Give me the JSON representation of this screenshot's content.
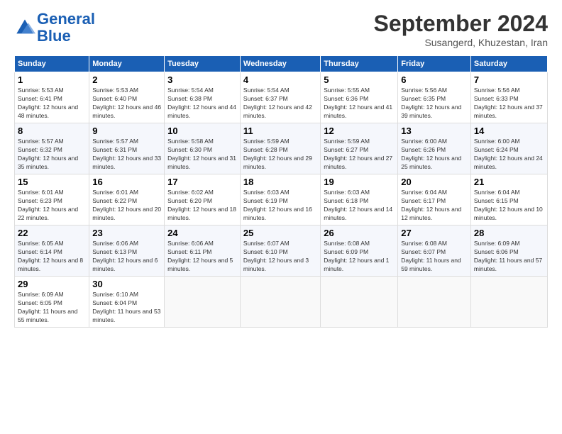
{
  "header": {
    "logo_line1": "General",
    "logo_line2": "Blue",
    "title": "September 2024",
    "subtitle": "Susangerd, Khuzestan, Iran"
  },
  "days_of_week": [
    "Sunday",
    "Monday",
    "Tuesday",
    "Wednesday",
    "Thursday",
    "Friday",
    "Saturday"
  ],
  "weeks": [
    [
      {
        "day": "1",
        "rise": "5:53 AM",
        "set": "6:41 PM",
        "daylight": "12 hours and 48 minutes."
      },
      {
        "day": "2",
        "rise": "5:53 AM",
        "set": "6:40 PM",
        "daylight": "12 hours and 46 minutes."
      },
      {
        "day": "3",
        "rise": "5:54 AM",
        "set": "6:38 PM",
        "daylight": "12 hours and 44 minutes."
      },
      {
        "day": "4",
        "rise": "5:54 AM",
        "set": "6:37 PM",
        "daylight": "12 hours and 42 minutes."
      },
      {
        "day": "5",
        "rise": "5:55 AM",
        "set": "6:36 PM",
        "daylight": "12 hours and 41 minutes."
      },
      {
        "day": "6",
        "rise": "5:56 AM",
        "set": "6:35 PM",
        "daylight": "12 hours and 39 minutes."
      },
      {
        "day": "7",
        "rise": "5:56 AM",
        "set": "6:33 PM",
        "daylight": "12 hours and 37 minutes."
      }
    ],
    [
      {
        "day": "8",
        "rise": "5:57 AM",
        "set": "6:32 PM",
        "daylight": "12 hours and 35 minutes."
      },
      {
        "day": "9",
        "rise": "5:57 AM",
        "set": "6:31 PM",
        "daylight": "12 hours and 33 minutes."
      },
      {
        "day": "10",
        "rise": "5:58 AM",
        "set": "6:30 PM",
        "daylight": "12 hours and 31 minutes."
      },
      {
        "day": "11",
        "rise": "5:59 AM",
        "set": "6:28 PM",
        "daylight": "12 hours and 29 minutes."
      },
      {
        "day": "12",
        "rise": "5:59 AM",
        "set": "6:27 PM",
        "daylight": "12 hours and 27 minutes."
      },
      {
        "day": "13",
        "rise": "6:00 AM",
        "set": "6:26 PM",
        "daylight": "12 hours and 25 minutes."
      },
      {
        "day": "14",
        "rise": "6:00 AM",
        "set": "6:24 PM",
        "daylight": "12 hours and 24 minutes."
      }
    ],
    [
      {
        "day": "15",
        "rise": "6:01 AM",
        "set": "6:23 PM",
        "daylight": "12 hours and 22 minutes."
      },
      {
        "day": "16",
        "rise": "6:01 AM",
        "set": "6:22 PM",
        "daylight": "12 hours and 20 minutes."
      },
      {
        "day": "17",
        "rise": "6:02 AM",
        "set": "6:20 PM",
        "daylight": "12 hours and 18 minutes."
      },
      {
        "day": "18",
        "rise": "6:03 AM",
        "set": "6:19 PM",
        "daylight": "12 hours and 16 minutes."
      },
      {
        "day": "19",
        "rise": "6:03 AM",
        "set": "6:18 PM",
        "daylight": "12 hours and 14 minutes."
      },
      {
        "day": "20",
        "rise": "6:04 AM",
        "set": "6:17 PM",
        "daylight": "12 hours and 12 minutes."
      },
      {
        "day": "21",
        "rise": "6:04 AM",
        "set": "6:15 PM",
        "daylight": "12 hours and 10 minutes."
      }
    ],
    [
      {
        "day": "22",
        "rise": "6:05 AM",
        "set": "6:14 PM",
        "daylight": "12 hours and 8 minutes."
      },
      {
        "day": "23",
        "rise": "6:06 AM",
        "set": "6:13 PM",
        "daylight": "12 hours and 6 minutes."
      },
      {
        "day": "24",
        "rise": "6:06 AM",
        "set": "6:11 PM",
        "daylight": "12 hours and 5 minutes."
      },
      {
        "day": "25",
        "rise": "6:07 AM",
        "set": "6:10 PM",
        "daylight": "12 hours and 3 minutes."
      },
      {
        "day": "26",
        "rise": "6:08 AM",
        "set": "6:09 PM",
        "daylight": "12 hours and 1 minute."
      },
      {
        "day": "27",
        "rise": "6:08 AM",
        "set": "6:07 PM",
        "daylight": "11 hours and 59 minutes."
      },
      {
        "day": "28",
        "rise": "6:09 AM",
        "set": "6:06 PM",
        "daylight": "11 hours and 57 minutes."
      }
    ],
    [
      {
        "day": "29",
        "rise": "6:09 AM",
        "set": "6:05 PM",
        "daylight": "11 hours and 55 minutes."
      },
      {
        "day": "30",
        "rise": "6:10 AM",
        "set": "6:04 PM",
        "daylight": "11 hours and 53 minutes."
      },
      null,
      null,
      null,
      null,
      null
    ]
  ]
}
